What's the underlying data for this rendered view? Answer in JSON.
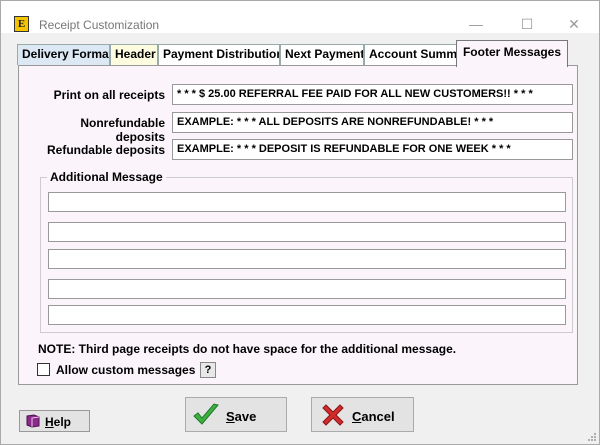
{
  "window": {
    "title": "Receipt Customization",
    "icon_letter": "E",
    "minimize": "—",
    "maximize": "☐",
    "close": "✕"
  },
  "tabs": [
    {
      "label": "Delivery Format",
      "active": false
    },
    {
      "label": "Header",
      "active": false
    },
    {
      "label": "Payment Distribution",
      "active": false
    },
    {
      "label": "Next Payment",
      "active": false
    },
    {
      "label": "Account Summary",
      "active": false
    },
    {
      "label": "Footer Messages",
      "active": true
    }
  ],
  "fields": {
    "print_all": {
      "label": "Print on all receipts",
      "value": "* * *  $ 25.00 REFERRAL FEE PAID FOR ALL NEW CUSTOMERS!!  * * *"
    },
    "nonrefundable": {
      "label": "Nonrefundable deposits",
      "value": "EXAMPLE: * * * ALL DEPOSITS ARE NONREFUNDABLE! * * *"
    },
    "refundable": {
      "label": "Refundable deposits",
      "value": "EXAMPLE: * * * DEPOSIT IS REFUNDABLE FOR ONE WEEK * * *"
    }
  },
  "additional": {
    "title": "Additional Message",
    "lines": [
      "",
      "",
      "",
      "",
      ""
    ]
  },
  "note": "NOTE: Third page receipts do not have space for the additional message.",
  "allow_custom": {
    "label": "Allow custom messages",
    "checked": false,
    "help": "?"
  },
  "buttons": {
    "help": {
      "accel": "H",
      "rest": "elp"
    },
    "save": {
      "accel": "S",
      "rest": "ave"
    },
    "cancel": {
      "accel": "C",
      "rest": "ancel"
    }
  },
  "colors": {
    "panel": "#fbf5fb",
    "tab_active": "#fbf5fb",
    "save_check": "#3cb043",
    "cancel_x": "#d12b2b"
  }
}
